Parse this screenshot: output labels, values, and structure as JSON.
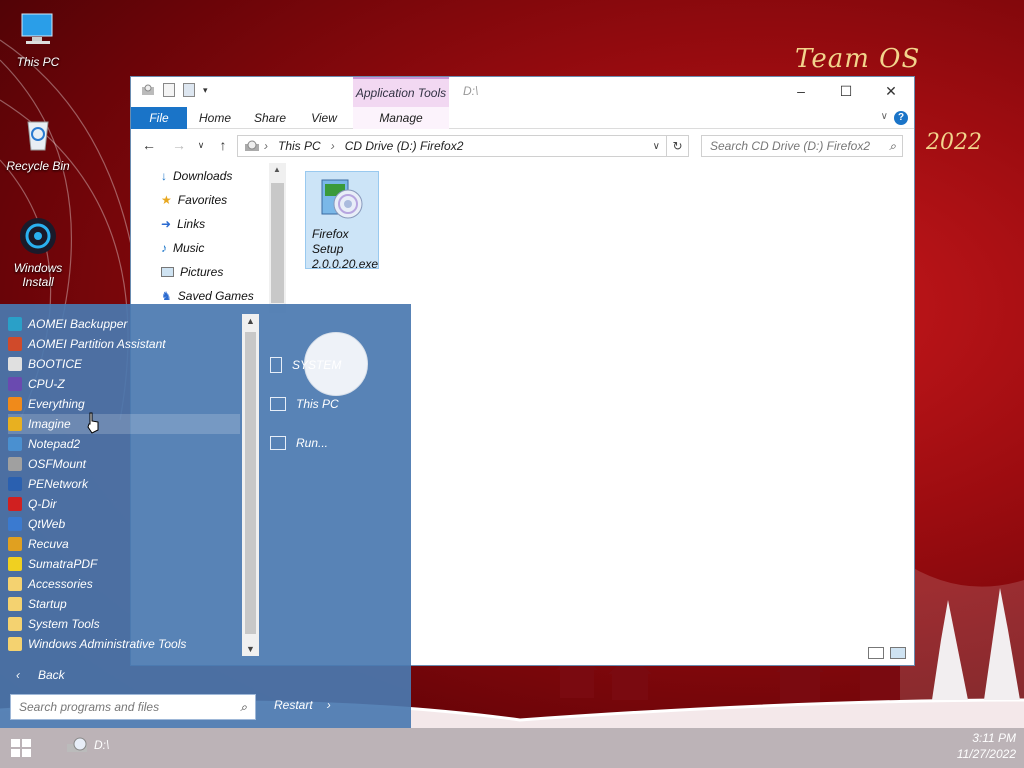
{
  "desktop": {
    "icons": [
      {
        "label": "This PC",
        "icon": "monitor-icon"
      },
      {
        "label": "Recycle Bin",
        "icon": "recycle-bin-icon"
      },
      {
        "label": "Windows Install",
        "icon": "windows-install-icon"
      }
    ],
    "wallpaper": {
      "brand": "Team OS",
      "year": "2022"
    }
  },
  "explorer": {
    "title_path": "D:\\",
    "contextual_tab": "Application Tools",
    "ribbon_tabs": [
      "File",
      "Home",
      "Share",
      "View",
      "Manage"
    ],
    "address": {
      "segments": [
        "This PC",
        "CD Drive (D:) Firefox2"
      ]
    },
    "search_placeholder": "Search CD Drive (D:) Firefox2",
    "nav_items": [
      "Downloads",
      "Favorites",
      "Links",
      "Music",
      "Pictures",
      "Saved Games"
    ],
    "files": [
      {
        "name": "Firefox Setup 2.0.0.20.exe",
        "line1": "Firefox",
        "line2": "Setup",
        "line3": "2.0.0.20.exe"
      }
    ],
    "colors": {
      "accent": "#1a74c8",
      "selection": "#cce4f7"
    }
  },
  "start_menu": {
    "programs": [
      {
        "label": "AOMEI Backupper",
        "color": "#2aa0c8"
      },
      {
        "label": "AOMEI Partition Assistant",
        "color": "#d04a2a"
      },
      {
        "label": "BOOTICE",
        "color": "#e0e0e0"
      },
      {
        "label": "CPU-Z",
        "color": "#6a4ab0"
      },
      {
        "label": "Everything",
        "color": "#f08a1a"
      },
      {
        "label": "Imagine",
        "color": "#e8b020"
      },
      {
        "label": "Notepad2",
        "color": "#4a90d0"
      },
      {
        "label": "OSFMount",
        "color": "#a0a0a0"
      },
      {
        "label": "PENetwork",
        "color": "#2a60b0"
      },
      {
        "label": "Q-Dir",
        "color": "#d02020"
      },
      {
        "label": "QtWeb",
        "color": "#3a7ad0"
      },
      {
        "label": "Recuva",
        "color": "#e0a020"
      },
      {
        "label": "SumatraPDF",
        "color": "#f0d020"
      },
      {
        "label": "Accessories",
        "color": "#f4d270"
      },
      {
        "label": "Startup",
        "color": "#f4d270"
      },
      {
        "label": "System Tools",
        "color": "#f4d270"
      },
      {
        "label": "Windows Administrative Tools",
        "color": "#f4d270"
      }
    ],
    "right_items": [
      "SYSTEM",
      "This PC",
      "Run..."
    ],
    "back_label": "Back",
    "search_placeholder": "Search programs and files",
    "restart_label": "Restart"
  },
  "taskbar": {
    "drive_label": "D:\\",
    "time": "3:11 PM",
    "date": "11/27/2022"
  }
}
